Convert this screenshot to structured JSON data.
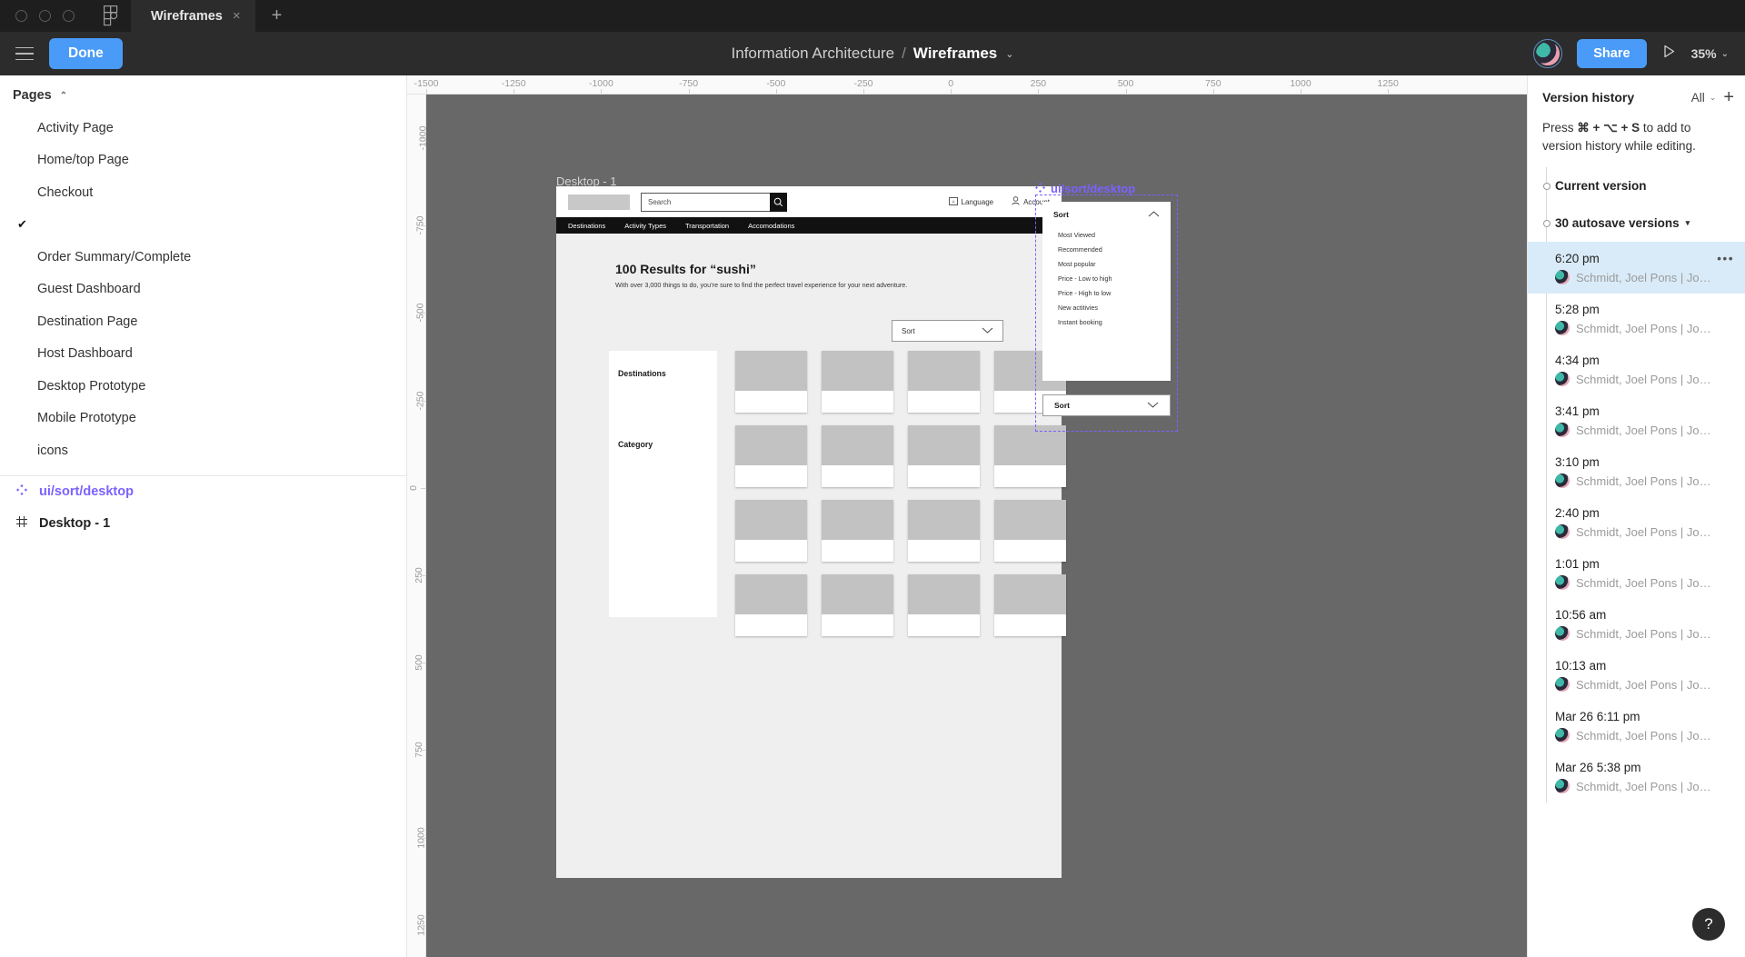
{
  "titlebar": {
    "app_icon": "figma-logo-icon",
    "tabs": [
      {
        "label": "Wireframes",
        "close": "×"
      }
    ],
    "new_tab": "+"
  },
  "toolbar": {
    "menu_icon": "hamburger-menu-icon",
    "done_label": "Done",
    "breadcrumb": {
      "project": "Information Architecture",
      "separator": "/",
      "file": "Wireframes",
      "caret": "⌄"
    },
    "share_label": "Share",
    "present_icon": "play-icon",
    "zoom_level": "35%",
    "zoom_caret": "⌄"
  },
  "sidebar": {
    "section_title": "Pages",
    "collapse_caret": "⌃",
    "pages": [
      {
        "label": "Activity Page",
        "checked": false
      },
      {
        "label": "Home/top Page",
        "checked": false
      },
      {
        "label": "Checkout",
        "checked": false
      },
      {
        "label": "",
        "checked": true
      },
      {
        "label": "Order Summary/Complete",
        "checked": false
      },
      {
        "label": "Guest Dashboard",
        "checked": false
      },
      {
        "label": "Destination Page",
        "checked": false
      },
      {
        "label": "Host Dashboard",
        "checked": false
      },
      {
        "label": "Desktop Prototype",
        "checked": false
      },
      {
        "label": "Mobile Prototype",
        "checked": false
      },
      {
        "label": "icons",
        "checked": false
      }
    ],
    "layers": [
      {
        "label": "ui/sort/desktop",
        "icon": "component-icon",
        "type": "component"
      },
      {
        "label": "Desktop - 1",
        "icon": "frame-icon",
        "type": "frame"
      }
    ]
  },
  "rulers": {
    "horizontal": [
      "-1500",
      "-1250",
      "-1000",
      "-750",
      "-500",
      "-250",
      "0",
      "250",
      "500",
      "750",
      "1000",
      "1250"
    ],
    "vertical": [
      "-1000",
      "-750",
      "-500",
      "-250",
      "0",
      "250",
      "500",
      "750",
      "1000",
      "1250"
    ]
  },
  "canvas": {
    "frame_label": "Desktop - 1",
    "wireframe": {
      "search_placeholder": "Search",
      "search_icon": "magnifier-icon",
      "language_label": "Language",
      "language_icon": "translate-icon",
      "account_label": "Account",
      "account_icon": "person-icon",
      "nav": [
        "Destinations",
        "Activity Types",
        "Transportation",
        "Accomodations"
      ],
      "heading": "100 Results for “sushi”",
      "subheading": "With over 3,000 things to do, you’re sure to find the perfect travel experience for your next adventure.",
      "sort_label": "Sort",
      "sort_caret": "⌄",
      "filters": [
        "Destinations",
        "Category"
      ],
      "card_count": 16
    },
    "component": {
      "name": "ui/sort/desktop",
      "icon": "component-diamond-icon",
      "open_dropdown": {
        "label": "Sort",
        "caret": "⌃",
        "options": [
          "Most Viewed",
          "Recommended",
          "Most popular",
          "Price - Low to high",
          "Price - High to low",
          "New actitivies",
          "Instant booking"
        ]
      },
      "closed_dropdown": {
        "label": "Sort",
        "caret": "⌄"
      }
    }
  },
  "version_history": {
    "title": "Version history",
    "filter_label": "All",
    "filter_caret": "⌄",
    "add_icon": "plus-icon",
    "hint_prefix": "Press ",
    "hint_shortcut": "⌘ + ⌥ + S",
    "hint_suffix": " to add to version history while editing.",
    "current_version_label": "Current version",
    "autosave_label": "30 autosave versions",
    "autosave_caret": "▾",
    "more_icon": "•••",
    "entries": [
      {
        "time": "6:20 pm",
        "author": "Schmidt, Joel Pons | Jo…",
        "selected": true
      },
      {
        "time": "5:28 pm",
        "author": "Schmidt, Joel Pons | Jo…",
        "selected": false
      },
      {
        "time": "4:34 pm",
        "author": "Schmidt, Joel Pons | Jo…",
        "selected": false
      },
      {
        "time": "3:41 pm",
        "author": "Schmidt, Joel Pons | Jo…",
        "selected": false
      },
      {
        "time": "3:10 pm",
        "author": "Schmidt, Joel Pons | Jo…",
        "selected": false
      },
      {
        "time": "2:40 pm",
        "author": "Schmidt, Joel Pons | Jo…",
        "selected": false
      },
      {
        "time": "1:01 pm",
        "author": "Schmidt, Joel Pons | Jo…",
        "selected": false
      },
      {
        "time": "10:56 am",
        "author": "Schmidt, Joel Pons | Jo…",
        "selected": false
      },
      {
        "time": "10:13 am",
        "author": "Schmidt, Joel Pons | Jo…",
        "selected": false
      },
      {
        "time": "Mar 26 6:11 pm",
        "author": "Schmidt, Joel Pons | Jo…",
        "selected": false
      },
      {
        "time": "Mar 26 5:38 pm",
        "author": "Schmidt, Joel Pons | Jo…",
        "selected": false
      }
    ]
  },
  "help": {
    "label": "?"
  },
  "colors": {
    "accent_blue": "#4a9bf7",
    "component_purple": "#7b61ff",
    "canvas_gray": "#686868",
    "selection_blue": "#d9ebf8"
  }
}
